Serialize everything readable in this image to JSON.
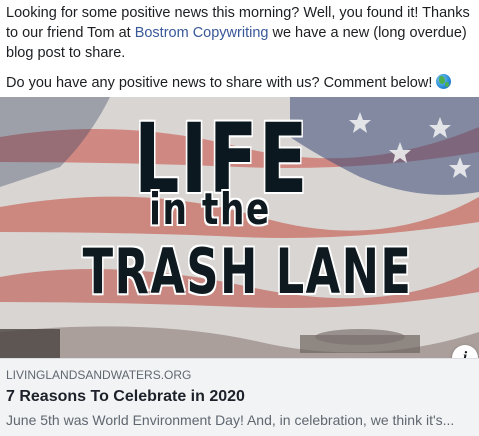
{
  "post": {
    "text_before_mention": "Looking for some positive news this morning? Well, you found it! Thanks to our friend Tom at ",
    "mention": "Bostrom Copywriting",
    "text_after_mention": " we have a new (long overdue) blog post to share.",
    "second_paragraph": "Do you have any positive news to share with us? Comment below!",
    "emoji": "globe-emoji"
  },
  "link_card": {
    "image": {
      "line1": "LIFE",
      "line2": "in the",
      "line3": "TRASH LANE",
      "background_icon": "american-flag"
    },
    "info_button": "i",
    "domain": "LIVINGLANDSANDWATERS.ORG",
    "title": "7 Reasons To Celebrate in 2020",
    "description": "June 5th was World Environment Day! And, in celebration, we think it's..."
  },
  "colors": {
    "mention_link": "#385898",
    "card_meta_bg": "#f2f3f5",
    "flag_red": "#c0392b",
    "flag_blue": "#2c3e6b"
  }
}
